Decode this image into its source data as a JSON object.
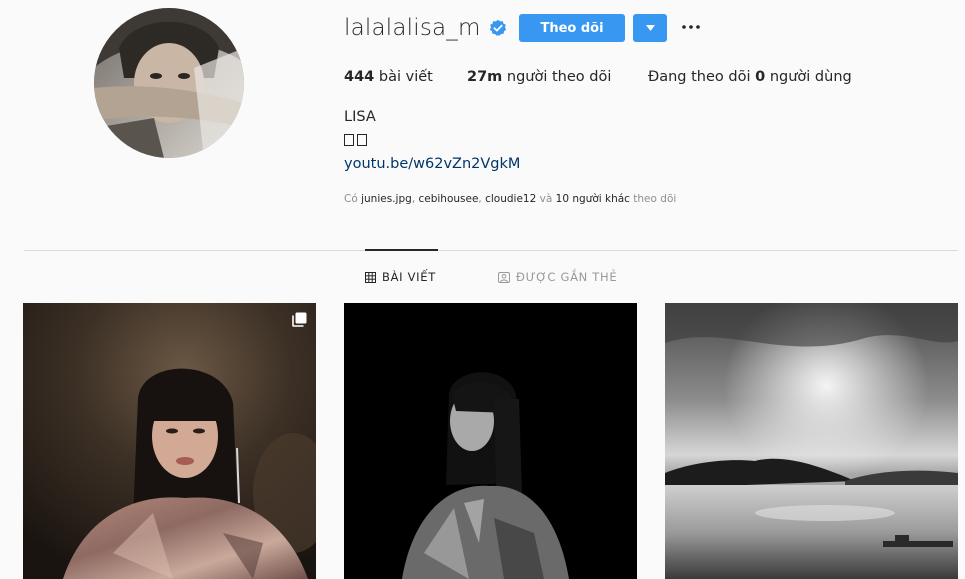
{
  "profile": {
    "username": "lalalalisa_m",
    "verified": true,
    "follow_label": "Theo dõi",
    "full_name": "LISA",
    "bio_link": "youtu.be/w62vZn2VgkM"
  },
  "stats": {
    "posts_count": "444",
    "posts_label": "bài viết",
    "followers_count": "27m",
    "followers_label": "người theo dõi",
    "following_prefix": "Đang theo dõi",
    "following_count": "0",
    "following_suffix": "người dùng"
  },
  "followed_by": {
    "prefix": "Có",
    "users": [
      "junies.jpg",
      "cebihousee",
      "cloudie12"
    ],
    "sep1": ",",
    "sep2": ",",
    "and": "và",
    "others": "10 người khác",
    "suffix": "theo dõi"
  },
  "tabs": [
    {
      "label": "BÀI VIẾT",
      "icon": "grid-icon",
      "active": true
    },
    {
      "label": "ĐƯỢC GẮN THẺ",
      "icon": "tag-icon",
      "active": false
    }
  ],
  "posts": [
    {
      "type": "photo",
      "multi": true
    },
    {
      "type": "photo",
      "multi": false
    },
    {
      "type": "photo",
      "multi": false
    }
  ],
  "colors": {
    "primary_button": "#3897f0",
    "link": "#003569",
    "verified_badge": "#3897f0",
    "muted": "#8e8e8e"
  }
}
